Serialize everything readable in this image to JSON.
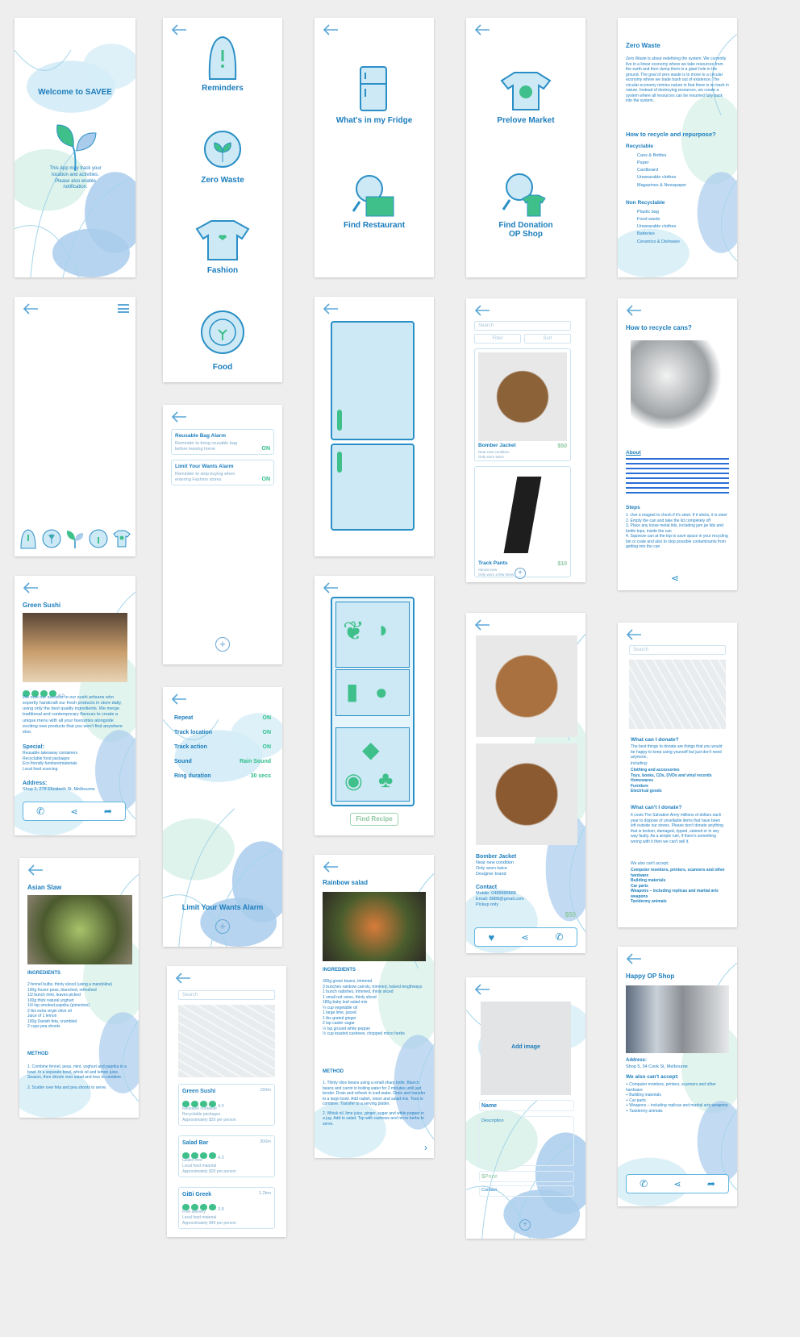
{
  "colors": {
    "primary": "#1b7dbd",
    "accent": "#3fc08b",
    "light": "#cbe8f4"
  },
  "welcome": {
    "title": "Welcome to SAVEE",
    "note": "This App may track your location and activities. Please also enable notification."
  },
  "menu": {
    "items": [
      "Reminders",
      "Zero Waste",
      "Fashion",
      "Food"
    ]
  },
  "fridge_menu": {
    "items": [
      "What's in my Fridge",
      "Find Restaurant"
    ]
  },
  "market_menu": {
    "items": [
      "Prelove Market",
      "Find Donation OP Shop"
    ]
  },
  "zero_waste": {
    "title": "Zero Waste",
    "body": "Zero Waste is about redefining the system. We currently live in a linear economy where we take resources from the earth and then dump them in a giant hole in the ground. The goal of zero waste is to move to a circular economy where we trade trash out of existence. The circular economy mimics nature in that there is no trash in nature. Instead of destroying resources, we create a system where all resources can be resumed fully back into the system.",
    "q": "How to recycle and repurpose?",
    "recyclable": "Recyclable",
    "rec_items": [
      "Cans & Bottles",
      "Paper",
      "Cardboard",
      "Unwearable clothes",
      "Magazines & Newspaper"
    ],
    "non": "Non Recyclable",
    "non_items": [
      "Plastic bag",
      "Food waste",
      "Unwearable clothes",
      "Batteries",
      "Ceramics & Dishware"
    ]
  },
  "alarms": {
    "items": [
      {
        "title": "Reusable Bag Alarm",
        "sub": "Reminder to bring reusable bag before leaving home",
        "state": "ON"
      },
      {
        "title": "Limit Your Wants Alarm",
        "sub": "Reminder to stop buying when entering Fashion stores",
        "state": "ON"
      }
    ]
  },
  "alarm_settings": {
    "rows": [
      {
        "k": "Repeat",
        "v": "ON"
      },
      {
        "k": "Track location",
        "v": "ON"
      },
      {
        "k": "Track action",
        "v": "ON"
      },
      {
        "k": "Sound",
        "v": "Rain Sound"
      },
      {
        "k": "Ring duration",
        "v": "30 secs"
      }
    ],
    "footer": "Limit Your Wants Alarm"
  },
  "market": {
    "search": "Search",
    "filter": "Filter",
    "sort": "Sort",
    "items": [
      {
        "name": "Bomber Jacket",
        "price": "$50",
        "sub1": "Near new condition",
        "sub2": "Only worn twice"
      },
      {
        "name": "Track Pants",
        "price": "$10",
        "sub1": "Almost new",
        "sub2": "Only worn a few times"
      }
    ]
  },
  "cans": {
    "title": "How to recycle cans?",
    "about": "About",
    "steps_title": "Steps",
    "steps": [
      "1. Use a magnet to check if it's steel. If it sticks, it is steel",
      "2. Empty the can and take the lid completely off",
      "3. Place any loose metal lids, including jam jar lids and bottle tops, inside the can",
      "4. Squeeze can at the top to save space in your recycling bin or crate and also to stop possible contaminants from getting into the can"
    ]
  },
  "sushi": {
    "title": "Green Sushi",
    "rating": "4.0",
    "desc": "We owe our success to our sushi artisans who expertly handcraft our fresh products in store daily, using only the best quality ingredients. We merge traditional and contemporary flavours to create a unique menu with all your favourites alongside exciting new products that you won't find anywhere else.",
    "special_t": "Special:",
    "special": [
      "Reusable takeaway containers",
      "Recyclable food packages",
      "Eco friendly furniture/materials",
      "Local food sourcing"
    ],
    "addr_t": "Address:",
    "addr": "Shop 2, 278 Elizabeth St, Melbourne"
  },
  "recipe_btn": "Find Recipe",
  "jacket": {
    "name": "Bomber Jacket",
    "l1": "Near new condition",
    "l2": "Only worn twice",
    "l3": "Designer brand",
    "contact_t": "Contact",
    "mobile": "Mobile: 0488888888",
    "email": "Email: 8888@gmail.com",
    "pickup": "Pickup only",
    "price": "$50"
  },
  "donate": {
    "search": "Search",
    "q1": "What can I donate?",
    "a1": "The best things to donate are things that you would be happy to keep using yourself but just don't need anymore,",
    "incl": "including:",
    "list": [
      "Clothing and accessories",
      "Toys, books, CDs, DVDs and vinyl records",
      "Homewares",
      "Furniture",
      "Electrical goods"
    ],
    "q2": "What can't I donate?",
    "a2": "It costs The Salvation Army millions of dollars each year to dispose of unsellable items that have been left outside our stores. Please don't donate anything that is broken, damaged, ripped, stained or in any way faulty. As a simple rule, if there's something wrong with it then we can't sell it.",
    "also": "We also can't accept:",
    "alist": [
      "Computer monitors, printers, scanners and other hardware",
      "Building materials",
      "Car parts",
      "Weapons – including replicas and martial arts weapons",
      "Taxidermy animals"
    ]
  },
  "slaw": {
    "title": "Asian Slaw",
    "ing_t": "INGREDIENTS",
    "ing": [
      "2 fennel bulbs, thinly sliced (using a mandoline)",
      "100g frozen peas, blanched, refreshed",
      "1/2 bunch mint, leaves picked",
      "100g thick natural yoghurt",
      "1/4 tsp smoked paprika (pimenton)",
      "2 tbs extra virgin olive oil",
      "Juice of 1 lemon",
      "100g Danish feta, crumbled",
      "2 cups pea shoots"
    ],
    "meth_t": "METHOD",
    "meth": [
      "1. Combine fennel, peas, mint, yoghurt and paprika in a bowl. In a separate bowl, whisk oil and lemon juice. Season, then drizzle over salad and toss to combine.",
      "2. Scatter over feta and pea shoots to serve."
    ]
  },
  "restaurants": {
    "search": "Search",
    "items": [
      {
        "name": "Green Sushi",
        "dist": "150m",
        "rating": "4.0",
        "l1": "Reusable container",
        "l2": "Recyclable packages",
        "l3": "Approximately $20 per person"
      },
      {
        "name": "Salad Bar",
        "dist": "300m",
        "rating": "4.3",
        "l1": "Gluten free",
        "l2": "Local food material",
        "l3": "Approximately $20 per person"
      },
      {
        "name": "GiBi Greek",
        "dist": "1.2km",
        "rating": "3.8",
        "l1": "Free delivery",
        "l2": "Local food material",
        "l3": "Approximately $40 per person"
      }
    ]
  },
  "salad": {
    "title": "Rainbow salad",
    "ing_t": "INGREDIENTS",
    "ing": [
      "300g green beans, trimmed",
      "3 bunches rainbow carrots, trimmed, halved lengthways",
      "1 bunch radishes, trimmed, thinly sliced",
      "1 small red onion, thinly sliced",
      "180g baby leaf salad mix",
      "¼ cup vegetable oil",
      "1 large lime, juiced",
      "1 tbs grated ginger",
      "2 tsp caster sugar",
      "½ tsp ground white pepper",
      "½ cup toasted cashews, chopped micro herbs"
    ],
    "meth_t": "METHOD",
    "meth": [
      "1. Thinly slice beans using a small sharp knife. Blanch beans and carrot in boiling water for 2 minutes until just tender. Drain and refresh in iced water. Drain and transfer to a large bowl. Add radish, onion and salad mix. Toss to combine. Transfer to a serving platter.",
      "2. Whisk oil, lime juice, ginger, sugar and white pepper in a jug. Add to salad. Top with cashews and micro herbs to serve."
    ]
  },
  "add": {
    "image": "Add image",
    "name": "Name",
    "desc": "Description",
    "price": "$Price",
    "contact": "Contact"
  },
  "opshop": {
    "title": "Happy OP Shop",
    "addr_t": "Address:",
    "addr": "Shop 5, 34 Cook St, Melbourne",
    "also": "We also can't accept:",
    "list": [
      "+ Computer monitors, printers, scanners and other hardware",
      "+ Building materials",
      "+ Car parts",
      "+ Weapons – including replicas and martial arts weapons",
      "+ Taxidermy animals"
    ]
  }
}
